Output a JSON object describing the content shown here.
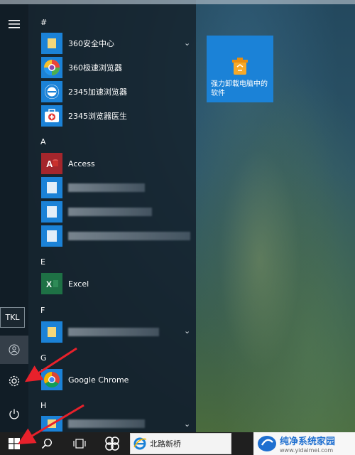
{
  "start_menu": {
    "rail": {
      "tooltip_label": "TKL"
    },
    "groups": [
      {
        "letter": "#"
      },
      {
        "letter": "A"
      },
      {
        "letter": "E"
      },
      {
        "letter": "F"
      },
      {
        "letter": "G"
      },
      {
        "letter": "H"
      }
    ],
    "apps": {
      "a360_safe": "360安全中心",
      "a360_browser": "360极速浏览器",
      "a2345_browser": "2345加速浏览器",
      "a2345_doctor": "2345浏览器医生",
      "access": "Access",
      "excel": "Excel",
      "chrome": "Google Chrome"
    },
    "tile": {
      "label": "强力卸载电脑中的软件"
    }
  },
  "taskbar": {
    "browser_tab_label": "北路新桥"
  },
  "watermark": {
    "title": "纯净系统家园",
    "url": "www.yidaimei.com"
  },
  "colors": {
    "tile_blue": "#1b82d7",
    "access_red": "#a4262c",
    "excel_green": "#1e7145",
    "arrow_red": "#e8212b"
  }
}
